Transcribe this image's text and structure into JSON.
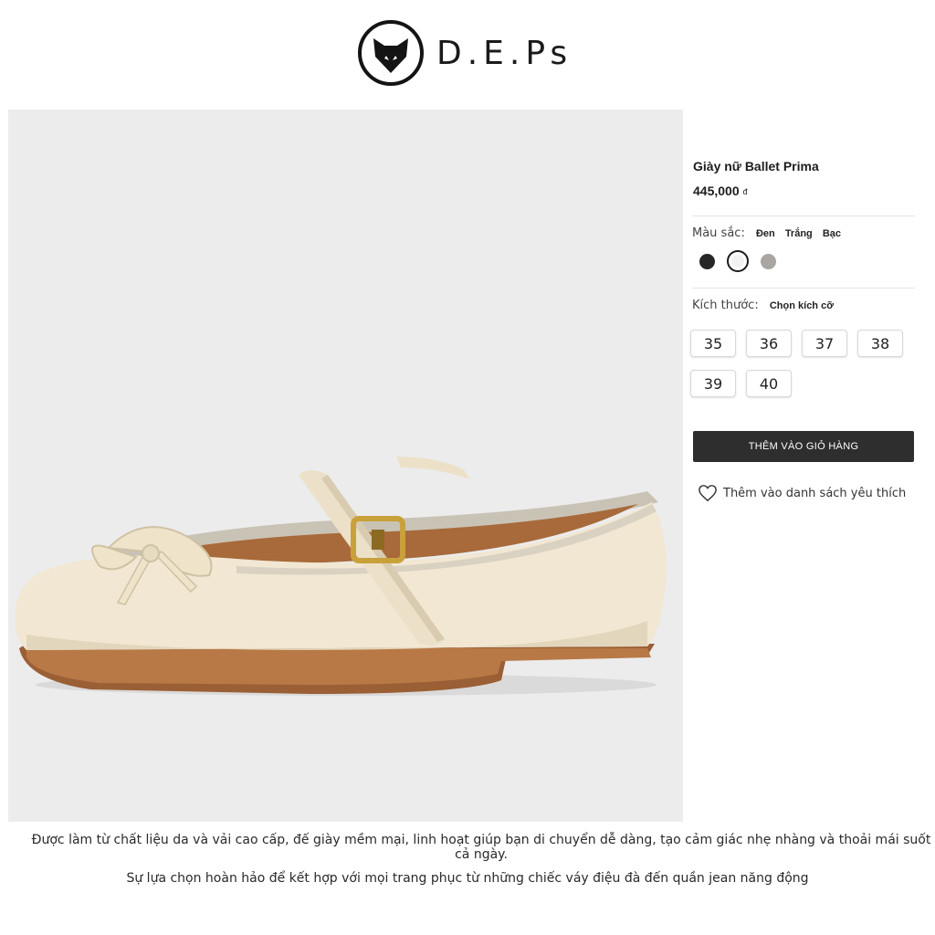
{
  "header": {
    "brand": "D.E.Ps",
    "logo_icon": "fox-head-icon"
  },
  "product": {
    "title": "Giày nữ Ballet Prima",
    "price": "445,000",
    "currency": "đ",
    "image_alt": "cream-mary-jane-ballet-flat"
  },
  "color": {
    "label": "Màu sắc:",
    "options": [
      "Đen",
      "Trắng",
      "Bạc"
    ],
    "swatches": [
      {
        "name": "Đen",
        "hex": "#262626"
      },
      {
        "name": "Trắng",
        "hex": "#f2f2f2",
        "selected": true
      },
      {
        "name": "Bạc",
        "hex": "#a9a6a1"
      }
    ]
  },
  "size": {
    "label": "Kích thước:",
    "placeholder": "Chọn kích cỡ",
    "options": [
      "35",
      "36",
      "37",
      "38",
      "39",
      "40"
    ]
  },
  "actions": {
    "add_to_cart": "THÊM VÀO GIỎ HÀNG",
    "wishlist": "Thêm vào danh sách yêu thích"
  },
  "description": {
    "line1": "Được làm từ chất liệu da và vải cao cấp, đế giày mềm mại, linh hoạt giúp bạn di chuyển dễ dàng, tạo cảm giác nhẹ nhàng và thoải mái suốt cả ngày.",
    "line2": "Sự lựa chọn hoàn hảo để kết hợp với mọi trang phục từ những chiếc váy điệu đà đến quần jean năng động"
  },
  "colors": {
    "button_bg": "#2e2e2e",
    "image_bg": "#ececec"
  }
}
